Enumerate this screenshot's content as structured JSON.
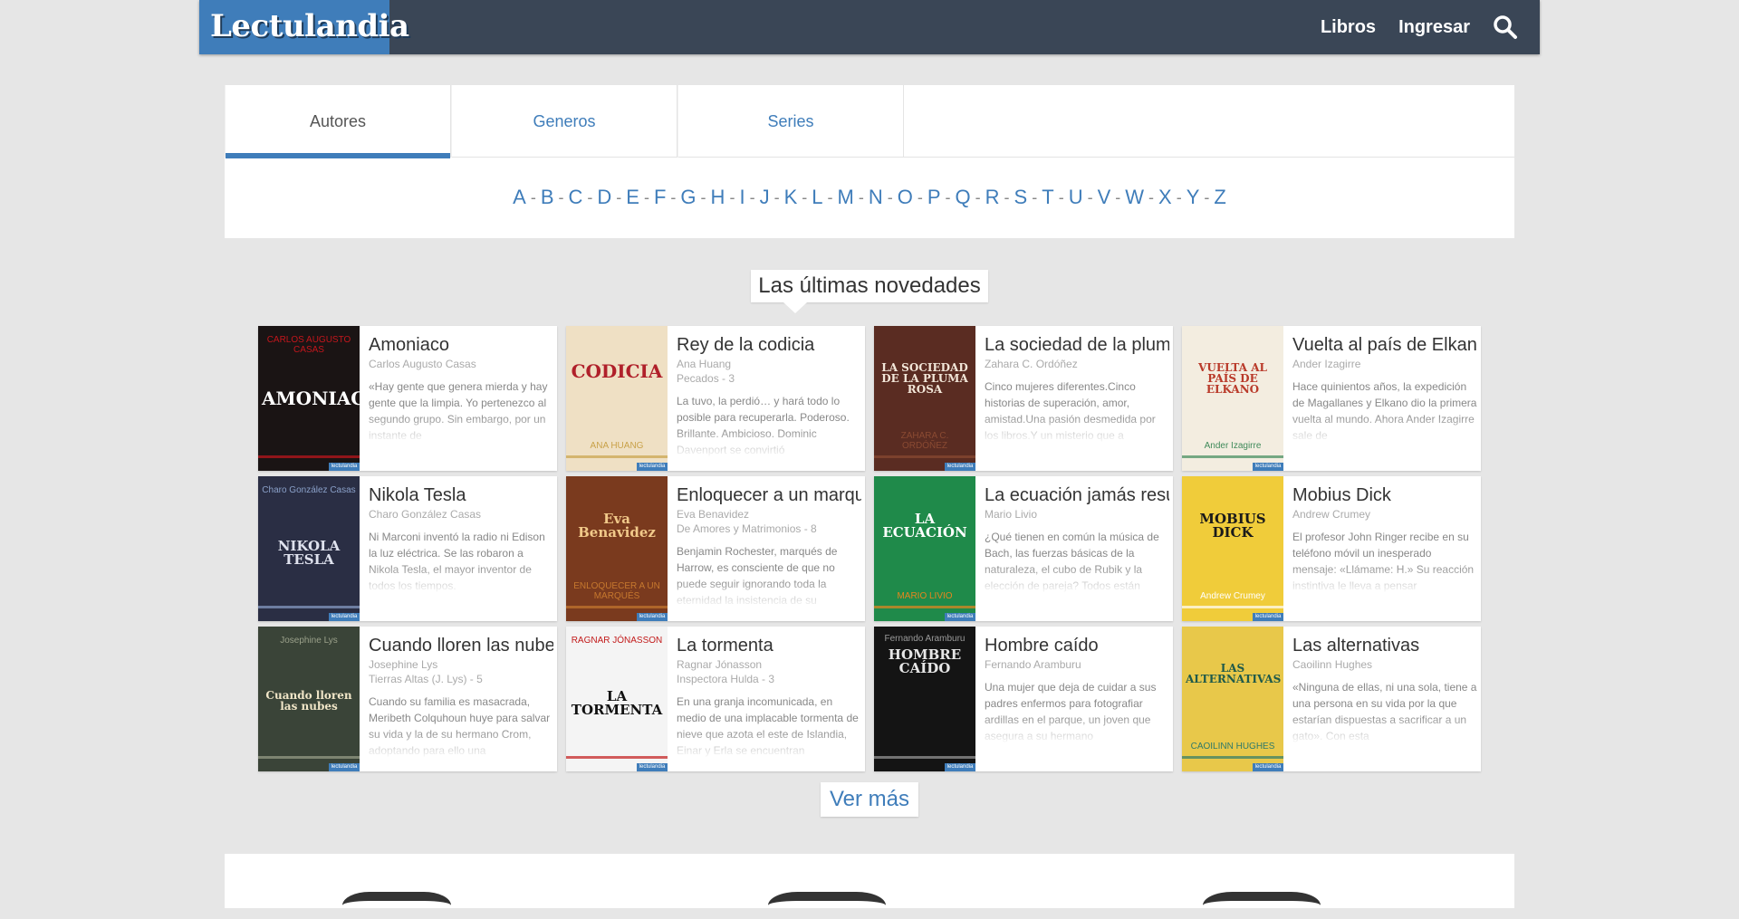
{
  "header": {
    "logo": "Lectulandia",
    "nav": [
      {
        "label": "Libros"
      },
      {
        "label": "Ingresar"
      }
    ],
    "search_icon": "search-icon"
  },
  "tabs": [
    {
      "label": "Autores",
      "active": true
    },
    {
      "label": "Generos",
      "active": false
    },
    {
      "label": "Series",
      "active": false
    }
  ],
  "letters": [
    "A",
    "B",
    "C",
    "D",
    "E",
    "F",
    "G",
    "H",
    "I",
    "J",
    "K",
    "L",
    "M",
    "N",
    "O",
    "P",
    "Q",
    "R",
    "S",
    "T",
    "U",
    "V",
    "W",
    "X",
    "Y",
    "Z"
  ],
  "section_title": "Las últimas novedades",
  "books": [
    {
      "title": "Amoniaco",
      "author": "Carlos Augusto Casas",
      "series": "",
      "desc": "«Hay gente que genera mierda y hay gente que la limpia. Yo pertenezco al segundo grupo. Sin embargo, por un instante de",
      "cover_title": "AMONIACO",
      "cover_author": "CARLOS AUGUSTO CASAS",
      "cover_bg": "#1a1414",
      "cover_fg": "#ffffff",
      "cover_accent": "#c4161c"
    },
    {
      "title": "Rey de la codicia",
      "author": "Ana Huang",
      "series": "Pecados - 3",
      "desc": "La tuvo, la perdió… y hará todo lo posible para recuperarla. Poderoso. Brillante. Ambicioso. Dominic Davenport se convirtió",
      "cover_title": "CODICIA",
      "cover_author": "ANA HUANG",
      "cover_bg": "#efe0c4",
      "cover_fg": "#b0202a",
      "cover_accent": "#c9a24a"
    },
    {
      "title": "La sociedad de la pluma rosa",
      "author": "Zahara C. Ordóñez",
      "series": "",
      "desc": "Cinco mujeres diferentes.Cinco historias de superación, amor, amistad.Una pasión desmedida por los libros.Y un misterio que a",
      "cover_title": "LA SOCIEDAD DE LA PLUMA ROSA",
      "cover_author": "ZAHARA C. ORDÓÑEZ",
      "cover_bg": "#5a2c22",
      "cover_fg": "#f2e6d8",
      "cover_accent": "#8a4a32"
    },
    {
      "title": "Vuelta al país de Elkano",
      "author": "Ander Izagirre",
      "series": "",
      "desc": "Hace quinientos años, la expedición de Magallanes y Elkano dio la primera vuelta al mundo. Ahora Ander Izagirre sale de",
      "cover_title": "VUELTA AL PAÍS DE ELKANO",
      "cover_author": "Ander Izagirre",
      "cover_bg": "#f3ede0",
      "cover_fg": "#b93a2a",
      "cover_accent": "#3f8a5a"
    },
    {
      "title": "Nikola Tesla",
      "author": "Charo González Casas",
      "series": "",
      "desc": "Ni Marconi inventó la radio ni Edison la luz eléctrica. Se las robaron a Nikola Tesla, el mayor inventor de todos los tiempos.",
      "cover_title": "NIKOLA TESLA",
      "cover_author": "Charo González Casas",
      "cover_bg": "#2a2e44",
      "cover_fg": "#dfe2ee",
      "cover_accent": "#8aa0c8"
    },
    {
      "title": "Enloquecer a un marqués",
      "author": "Eva Benavidez",
      "series": "De Amores y Matrimonios - 8",
      "desc": "Benjamin Rochester, marqués de Harrow, es consciente de que no puede seguir ignorando toda la eternidad la insistencia de su",
      "cover_title": "Eva Benavidez",
      "cover_author": "ENLOQUECER A UN MARQUÉS",
      "cover_bg": "#7a3a1e",
      "cover_fg": "#f1c98a",
      "cover_accent": "#c6782e"
    },
    {
      "title": "La ecuación jamás resuelta",
      "author": "Mario Livio",
      "series": "",
      "desc": "¿Qué tienen en común la música de Bach, las fuerzas básicas de la naturaleza, el cubo de Rubik y la elección de pareja? Todos están",
      "cover_title": "LA ECUACIÓN",
      "cover_author": "MARIO LIVIO",
      "cover_bg": "#1f8a4a",
      "cover_fg": "#ffffff",
      "cover_accent": "#e6861e"
    },
    {
      "title": "Mobius Dick",
      "author": "Andrew Crumey",
      "series": "",
      "desc": "El profesor John Ringer recibe en su teléfono móvil un inesperado mensaje: «Llámame: H.» Su reacción instintiva le lleva a pensar",
      "cover_title": "MOBIUS DICK",
      "cover_author": "Andrew Crumey",
      "cover_bg": "#f0cc3a",
      "cover_fg": "#1a1a1a",
      "cover_accent": "#ffffff"
    },
    {
      "title": "Cuando lloren las nubes",
      "author": "Josephine Lys",
      "series": "Tierras Altas (J. Lys) - 5",
      "desc": "Cuando su familia es masacrada, Meribeth Colquhoun huye para salvar su vida y la de su hermano Crom, adoptando para ello una",
      "cover_title": "Cuando lloren las nubes",
      "cover_author": "Josephine Lys",
      "cover_bg": "#3a4438",
      "cover_fg": "#f1e6c8",
      "cover_accent": "#9aa08a"
    },
    {
      "title": "La tormenta",
      "author": "Ragnar Jónasson",
      "series": "Inspectora Hulda - 3",
      "desc": "En una granja incomunicada, en medio de una implacable tormenta de nieve que azota el este de Islandia, Einar y Erla se encuentran",
      "cover_title": "LA TORMENTA",
      "cover_author": "RAGNAR JÓNASSON",
      "cover_bg": "#f4f4f4",
      "cover_fg": "#111111",
      "cover_accent": "#c21a1a"
    },
    {
      "title": "Hombre caído",
      "author": "Fernando Aramburu",
      "series": "",
      "desc": "Una mujer que deja de cuidar a sus padres enfermos para fotografiar ardillas en el parque, un joven que asegura a su hermano",
      "cover_title": "HOMBRE CAÍDO",
      "cover_author": "Fernando Aramburu",
      "cover_bg": "#141414",
      "cover_fg": "#e6e6e6",
      "cover_accent": "#9a9a9a"
    },
    {
      "title": "Las alternativas",
      "author": "Caoilinn Hughes",
      "series": "",
      "desc": "«Ninguna de ellas, ni una sola, tiene a una persona en su vida por la que estarían dispuestas a sacrificar a un gato». Con esta",
      "cover_title": "LAS ALTERNATIVAS",
      "cover_author": "CAOILINN HUGHES",
      "cover_bg": "#e8c84a",
      "cover_fg": "#1f5a4a",
      "cover_accent": "#2f7a6a"
    }
  ],
  "more_label": "Ver más",
  "cover_stamp": "lectulandia"
}
